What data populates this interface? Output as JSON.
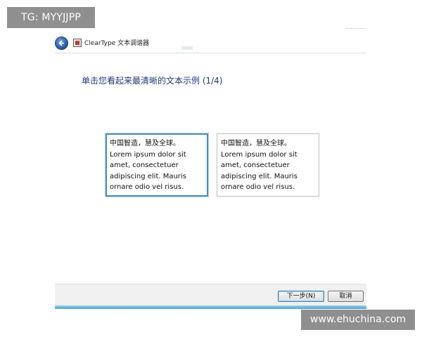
{
  "watermarks": {
    "top_left": "TG: MYYJJPP",
    "bottom_right": "www.ehuchina.com"
  },
  "window": {
    "title": "ClearType 文本调谐器",
    "heading": "单击您看起来最清晰的文本示例 (1/4)",
    "back_icon": "back-arrow-icon",
    "app_icon": "cleartype-app-icon"
  },
  "samples": [
    {
      "selected": true,
      "lines": [
        "中国智造，慧及全球。",
        "Lorem ipsum dolor sit",
        "amet, consectetuer",
        "adipiscing elit. Mauris",
        "ornare odio vel risus."
      ]
    },
    {
      "selected": false,
      "lines": [
        "中国智造，慧及全球。",
        "Lorem ipsum dolor sit",
        "amet, consectetuer",
        "adipiscing elit. Mauris",
        "ornare odio vel risus."
      ]
    }
  ],
  "footer": {
    "next_label": "下一步(N)",
    "cancel_label": "取消"
  },
  "colors": {
    "heading": "#1d3a7a",
    "selected_border": "#4b8fb8",
    "accent_bar": "#4aa0d0"
  }
}
